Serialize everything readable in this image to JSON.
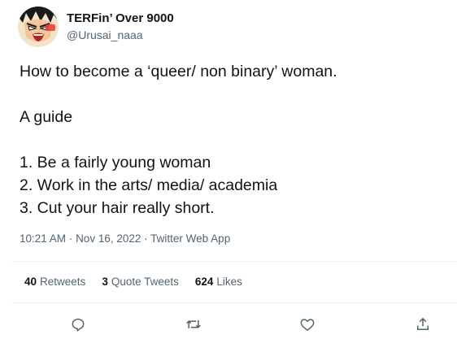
{
  "user": {
    "display_name": "TERFin’ Over 9000",
    "handle": "@Urusai_naaa",
    "avatar_icon": "anime-character-avatar"
  },
  "tweet": {
    "lines": [
      "How to become a ‘queer/ non binary’ woman.",
      "",
      "A guide",
      "",
      "1. Be a fairly young woman",
      "2. Work in the arts/ media/ academia",
      "3. Cut your hair really short."
    ],
    "time": "10:21 AM",
    "date": "Nov 16, 2022",
    "source": "Twitter Web App",
    "dot": "·"
  },
  "stats": {
    "retweets_count": "40",
    "retweets_label": "Retweets",
    "quotes_count": "3",
    "quotes_label": "Quote Tweets",
    "likes_count": "624",
    "likes_label": "Likes"
  },
  "actions": [
    {
      "name": "reply",
      "icon": "reply-icon"
    },
    {
      "name": "retweet",
      "icon": "retweet-icon"
    },
    {
      "name": "like",
      "icon": "heart-icon"
    },
    {
      "name": "share",
      "icon": "share-icon"
    }
  ],
  "colors": {
    "text_primary": "#0f1419",
    "text_secondary": "#536471",
    "divider": "#eff3f4"
  }
}
